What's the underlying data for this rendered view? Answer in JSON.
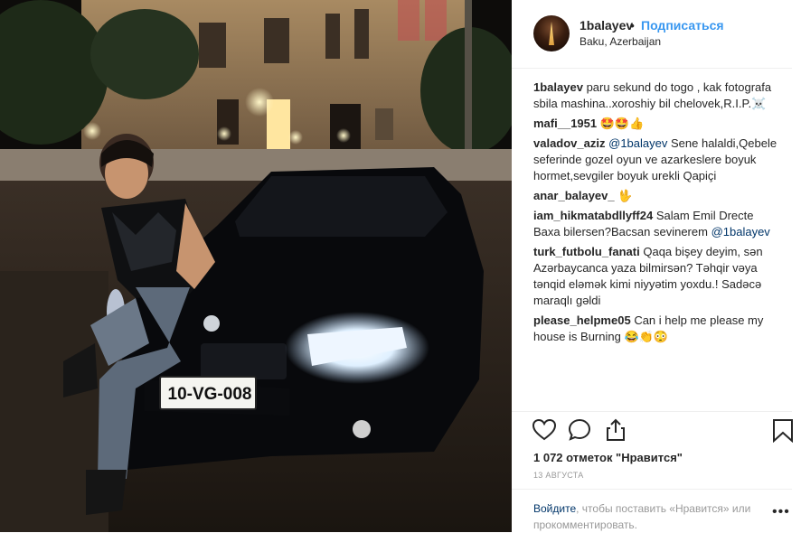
{
  "post": {
    "username": "1balayev",
    "dot": "•",
    "follow_label": "Подписаться",
    "location": "Baku, Azerbaijan",
    "plate": "10-VG-008"
  },
  "comments": [
    {
      "user": "1balayev",
      "mention": "",
      "text": "paru sekund do togo , kak fotografa sbila mashina..xoroshiy bil chelovek,R.I.P.☠️",
      "after": ""
    },
    {
      "user": "mafi__1951",
      "mention": "",
      "text": "🤩🤩👍",
      "after": ""
    },
    {
      "user": "valadov_aziz",
      "mention": "@1balayev",
      "text": "Sene halaldi,Qebele seferinde gozel oyun ve azarkeslere boyuk hormet,sevgiler boyuk urekli Qapiçi",
      "after": ""
    },
    {
      "user": "anar_balayev_",
      "mention": "",
      "text": "🖖",
      "after": ""
    },
    {
      "user": "iam_hikmatabdllyff24",
      "mention": "",
      "text": "Salam Emil Drecte Baxa bilersen?Bacsan sevinerem",
      "after": "@1balayev"
    },
    {
      "user": "turk_futbolu_fanati",
      "mention": "",
      "text": "Qaqa bişey deyim, sən Azərbaycanca yaza bilmirsən? Təhqir vəya tənqid eləmək kimi niyyətim yoxdu.! Sadəcə maraqlı gəldi",
      "after": ""
    },
    {
      "user": "please_helpme05",
      "mention": "",
      "text": "Can i help me please my house is Burning 😂👏😳",
      "after": ""
    }
  ],
  "actions": {
    "like_icon": "heart-icon",
    "comment_icon": "comment-bubble-icon",
    "share_icon": "share-icon",
    "save_icon": "bookmark-icon"
  },
  "likes_text": "1 072 отметок \"Нравится\"",
  "date_text": "13 АВГУСТА",
  "bottom": {
    "login_link": "Войдите",
    "prompt_text": ", чтобы поставить «Нравится» или прокомментировать.",
    "more": "•••"
  },
  "colors": {
    "accent": "#3897f0",
    "link": "#003569",
    "muted": "#999999"
  }
}
